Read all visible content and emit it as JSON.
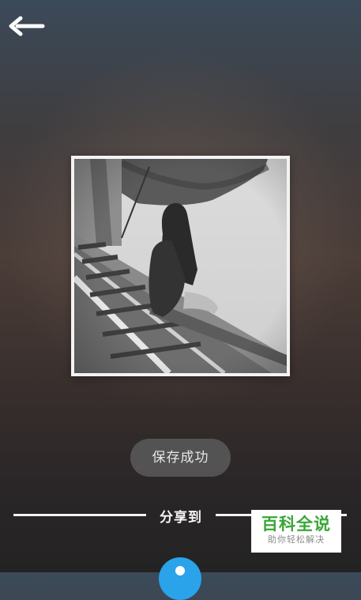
{
  "header": {
    "back_icon": "arrow-left-icon"
  },
  "toast": {
    "text": "保存成功"
  },
  "share": {
    "label": "分享到",
    "first_target_icon": "share-target-icon",
    "first_target_color": "#2aa3ea"
  },
  "watermark": {
    "title": "百科全说",
    "subtitle": "助你轻松解决"
  },
  "colors": {
    "accent": "#2aa3ea",
    "watermark_green": "#3aa638"
  }
}
